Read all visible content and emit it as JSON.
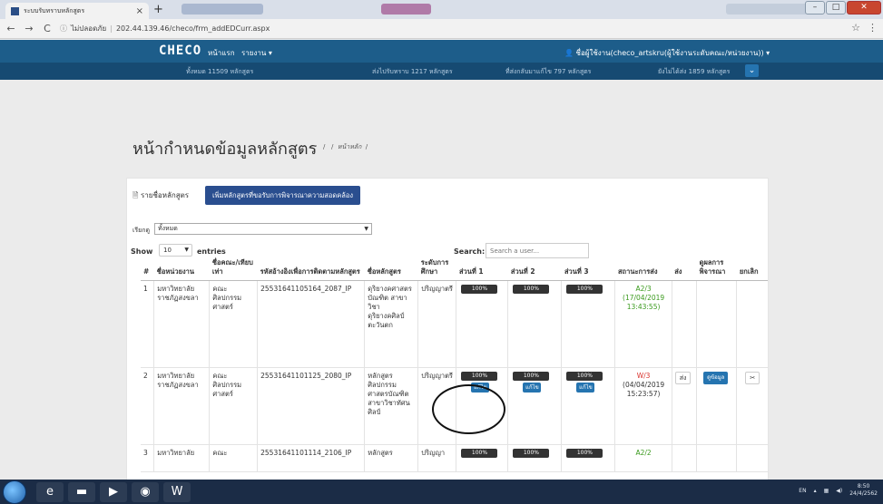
{
  "browser": {
    "tab_title": "ระบบรับทราบหลักสูตร",
    "tab_close": "×",
    "new_tab": "+",
    "back": "←",
    "forward": "→",
    "reload": "C",
    "security_label": "ไม่ปลอดภัย",
    "url": "202.44.139.46/checo/frm_addEDCurr.aspx",
    "star": "☆",
    "menu": "⋮"
  },
  "navbar": {
    "brand": "CHECO",
    "home": "หน้าแรก",
    "report": "รายงาน ▾",
    "user": "ชื่อผู้ใช้งาน(checo_artskru(ผู้ใช้งานระดับคณะ/หน่วยงาน)) ▾"
  },
  "stats": {
    "total": "ทั้งหมด 11509 หลักสูตร",
    "sent": "ส่งไปรับทราบ 1217 หลักสูตร",
    "returned": "ที่ส่งกลับมาแก้ไข 797 หลักสูตร",
    "not_sent": "ยังไม่ได้ส่ง 1859 หลักสูตร"
  },
  "page": {
    "title": "หน้ากำหนดข้อมูลหลักสูตร",
    "breadcrumb_sep": "/",
    "breadcrumb_home": "หน้าหลัก"
  },
  "card": {
    "list_label": "รายชื่อหลักสูตร",
    "add_button": "เพิ่มหลักสูตรที่ขอรับการพิจารณาความสอดคล้อง",
    "filter_label": "เรียกดู",
    "filter_value": "ทั้งหมด",
    "show_label": "Show",
    "show_value": "10",
    "entries_label": "entries",
    "search_label": "Search:",
    "search_placeholder": "Search a user..."
  },
  "table": {
    "headers": [
      "#",
      "ชื่อหน่วยงาน",
      "ชื่อคณะ/เทียบเท่า",
      "รหัสอ้างอิงเพื่อการติดตามหลักสูตร",
      "ชื่อหลักสูตร",
      "ระดับการศึกษา",
      "ส่วนที่ 1",
      "ส่วนที่ 2",
      "ส่วนที่ 3",
      "สถานะการส่ง",
      "ส่ง",
      "ดูผลการพิจารณา",
      "ยกเลิก"
    ],
    "rows": [
      {
        "num": "1",
        "org": "มหาวิทยาลัยราชภัฏสงขลา",
        "faculty": "คณะศิลปกรรมศาสตร์",
        "code": "25531641105164_2087_IP",
        "name": "ดุริยางคศาสตรบัณฑิต สาขาวิชาดุริยางคศิลป์ตะวันตก",
        "level": "ปริญญาตรี",
        "p1": "100%",
        "p2": "100%",
        "p3": "100%",
        "status": "A2/3",
        "status_date": "(17/04/2019 13:43:55)"
      },
      {
        "num": "2",
        "org": "มหาวิทยาลัยราชภัฏสงขลา",
        "faculty": "คณะศิลปกรรมศาสตร์",
        "code": "25531641101125_2080_IP",
        "name": "หลักสูตรศิลปกรรมศาสตรบัณฑิต สาขาวิชาทัศนศิลป์",
        "level": "ปริญญาตรี",
        "p1": "100%",
        "p2": "100%",
        "p3": "100%",
        "edit": "แก้ไข",
        "status": "W/3",
        "status_date": "(04/04/2019 15:23:57)",
        "send": "ส่ง",
        "view": "ดูข้อมูล",
        "cancel": "✂"
      },
      {
        "num": "3",
        "org": "มหาวิทยาลัย",
        "faculty": "คณะ",
        "code": "25531641101114_2106_IP",
        "name": "หลักสูตร",
        "level": "ปริญญา",
        "p1": "100%",
        "p2": "100%",
        "p3": "100%",
        "status": "A2/2"
      }
    ]
  },
  "taskbar": {
    "lang": "EN",
    "time": "8:50",
    "date": "24/4/2562"
  },
  "colors": {
    "navbar": "#1d5d8a",
    "statsbar": "#164a72",
    "accent": "#2574b0",
    "add_button": "#2a4e8f",
    "status_ok": "#3a9a1d",
    "status_wait": "#d9312b"
  }
}
